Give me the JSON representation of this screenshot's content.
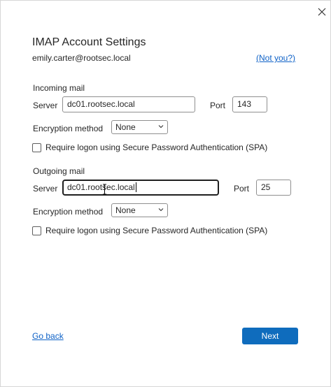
{
  "dialog": {
    "title": "IMAP Account Settings",
    "email": "emily.carter@rootsec.local",
    "not_you_link": "(Not you?)"
  },
  "incoming": {
    "section_label": "Incoming mail",
    "server_label": "Server",
    "server_value": "dc01.rootsec.local",
    "port_label": "Port",
    "port_value": "143",
    "encryption_label": "Encryption method",
    "encryption_value": "None",
    "spa_label": "Require logon using Secure Password Authentication (SPA)",
    "spa_checked": false
  },
  "outgoing": {
    "section_label": "Outgoing mail",
    "server_label": "Server",
    "server_value": "dc01.rootsec.local",
    "port_label": "Port",
    "port_value": "25",
    "encryption_label": "Encryption method",
    "encryption_value": "None",
    "spa_label": "Require logon using Secure Password Authentication (SPA)",
    "spa_checked": false
  },
  "footer": {
    "back_label": "Go back",
    "next_label": "Next"
  },
  "colors": {
    "accent": "#0f6cbd",
    "link": "#0f62c7",
    "text": "#262626",
    "border": "#8f8f8f"
  },
  "icons": {
    "close": "close-icon",
    "dropdown": "chevron-down-icon",
    "cursor": "text-cursor-icon"
  }
}
